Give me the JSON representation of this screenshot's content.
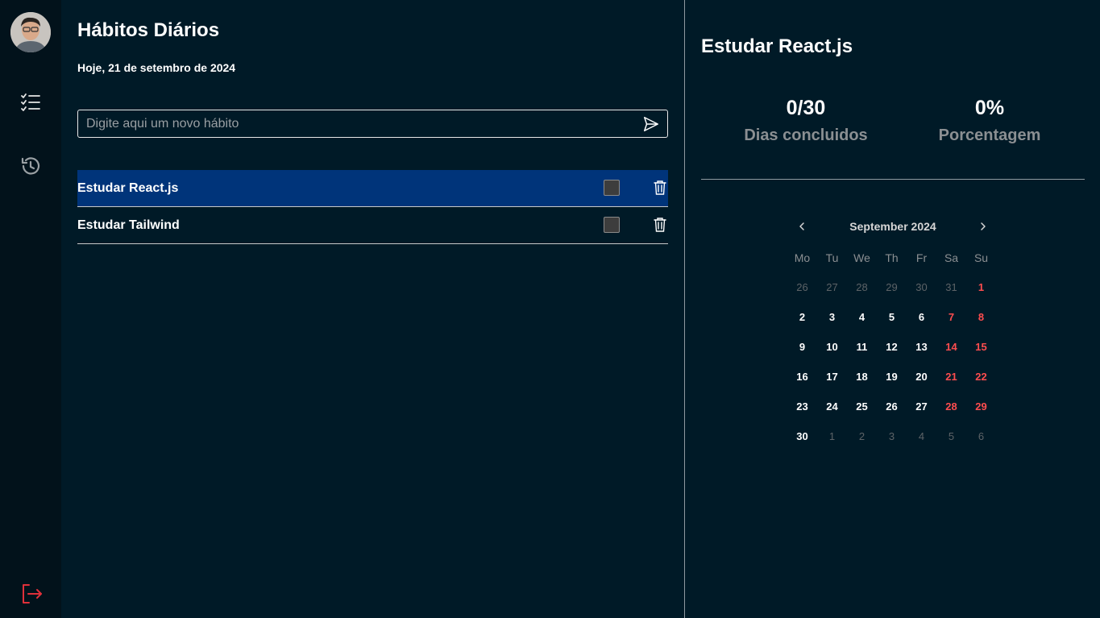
{
  "sidebar": {
    "avatar_alt": "",
    "nav": [
      "habits-list",
      "history"
    ],
    "logout_color": "#e0303a"
  },
  "main": {
    "title": "Hábitos Diários",
    "date": "Hoje, 21 de setembro de 2024",
    "input_placeholder": "Digite aqui um novo hábito",
    "habits": [
      {
        "name": "Estudar React.js",
        "selected": true,
        "checked": false
      },
      {
        "name": "Estudar Tailwind",
        "selected": false,
        "checked": false
      }
    ]
  },
  "panel": {
    "title": "Estudar React.js",
    "stats": [
      {
        "value": "0/30",
        "label": "Dias concluidos"
      },
      {
        "value": "0%",
        "label": "Porcentagem"
      }
    ]
  },
  "calendar": {
    "month_label": "September 2024",
    "weekdays": [
      "Mo",
      "Tu",
      "We",
      "Th",
      "Fr",
      "Sa",
      "Su"
    ],
    "days": [
      {
        "d": "26",
        "other": true
      },
      {
        "d": "27",
        "other": true
      },
      {
        "d": "28",
        "other": true
      },
      {
        "d": "29",
        "other": true
      },
      {
        "d": "30",
        "other": true
      },
      {
        "d": "31",
        "other": true
      },
      {
        "d": "1",
        "weekend": true
      },
      {
        "d": "2"
      },
      {
        "d": "3"
      },
      {
        "d": "4"
      },
      {
        "d": "5"
      },
      {
        "d": "6"
      },
      {
        "d": "7",
        "weekend": true
      },
      {
        "d": "8",
        "weekend": true
      },
      {
        "d": "9"
      },
      {
        "d": "10"
      },
      {
        "d": "11"
      },
      {
        "d": "12"
      },
      {
        "d": "13"
      },
      {
        "d": "14",
        "weekend": true
      },
      {
        "d": "15",
        "weekend": true
      },
      {
        "d": "16"
      },
      {
        "d": "17"
      },
      {
        "d": "18"
      },
      {
        "d": "19"
      },
      {
        "d": "20"
      },
      {
        "d": "21",
        "weekend": true
      },
      {
        "d": "22",
        "weekend": true
      },
      {
        "d": "23"
      },
      {
        "d": "24"
      },
      {
        "d": "25"
      },
      {
        "d": "26"
      },
      {
        "d": "27"
      },
      {
        "d": "28",
        "weekend": true
      },
      {
        "d": "29",
        "weekend": true
      },
      {
        "d": "30"
      },
      {
        "d": "1",
        "other": true
      },
      {
        "d": "2",
        "other": true
      },
      {
        "d": "3",
        "other": true
      },
      {
        "d": "4",
        "other": true
      },
      {
        "d": "5",
        "other": true
      },
      {
        "d": "6",
        "other": true
      }
    ]
  },
  "colors": {
    "background": "#001a27",
    "sidebar": "#02121b",
    "selected_row": "#00347a",
    "weekend": "#ff4d4f",
    "muted": "#8b8f92"
  }
}
